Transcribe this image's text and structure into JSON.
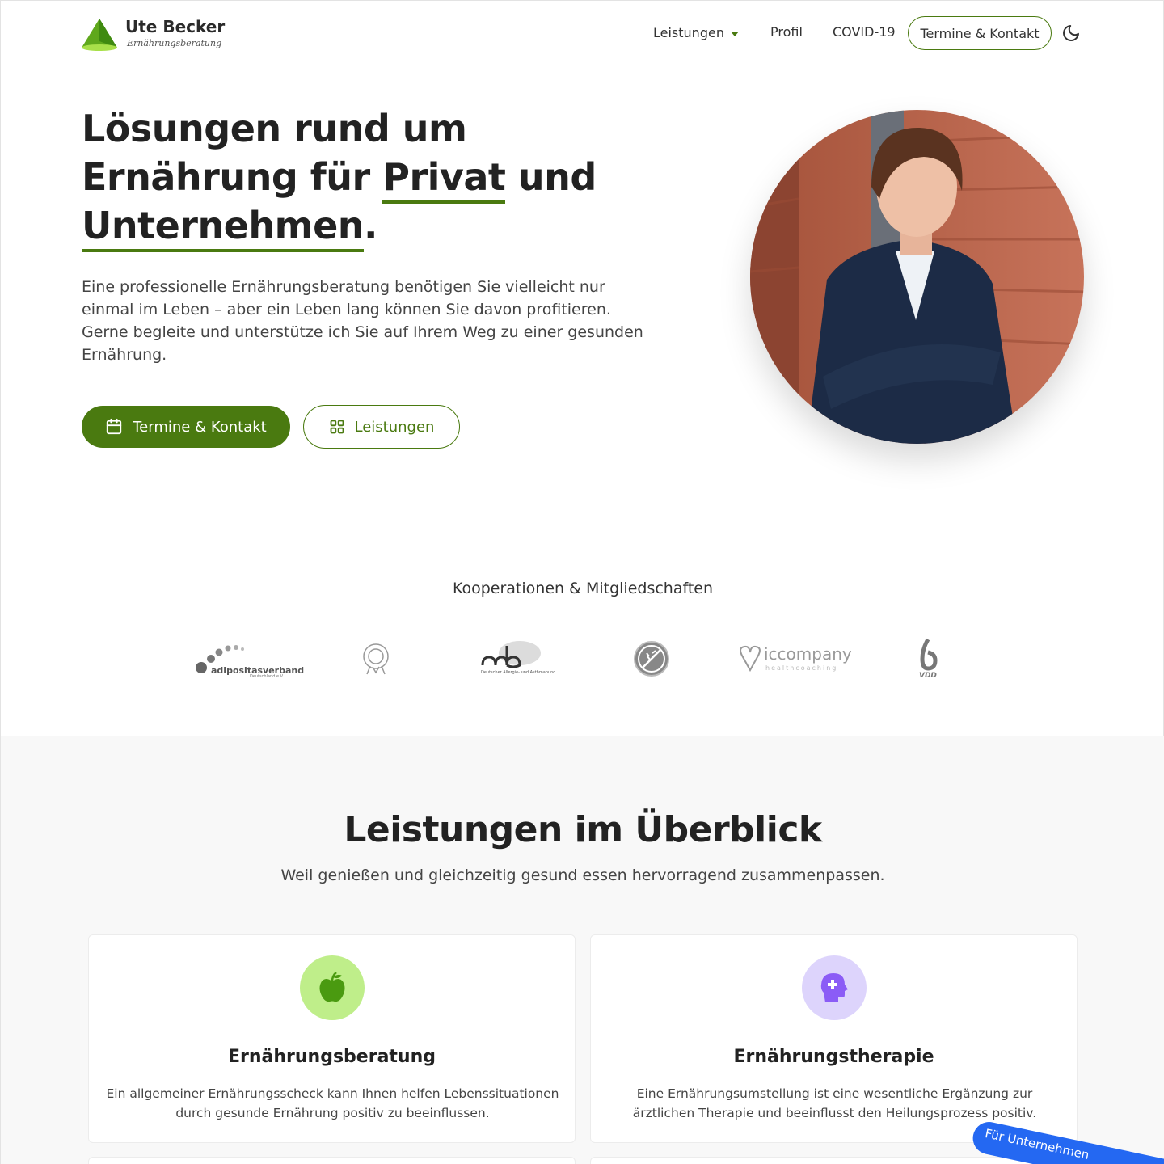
{
  "brand": {
    "name": "Ute Becker",
    "tagline": "Ernährungsberatung"
  },
  "nav": {
    "items": [
      {
        "label": "Leistungen"
      },
      {
        "label": "Profil"
      },
      {
        "label": "COVID-19"
      }
    ],
    "cta_label": "Termine & Kontakt"
  },
  "hero": {
    "title_1": "Lösungen rund um",
    "title_2a": "Ernährung für ",
    "title_2b": "Privat",
    "title_2c": " und",
    "title_3a": "Unternehmen",
    "title_3b": ".",
    "text": "Eine professionelle Ernährungsberatung benötigen Sie vielleicht nur einmal im Leben – aber ein Leben lang können Sie davon profitieren. Gerne begleite und unterstütze ich Sie auf Ihrem Weg zu einer gesunden Ernährung.",
    "primary_button": "Termine & Kontakt",
    "secondary_button": "Leistungen"
  },
  "partners": {
    "title": "Kooperationen & Mitgliedschaften",
    "logos": [
      {
        "name": "adipositasverband",
        "sub": "Deutschland e.V."
      },
      {
        "name": "emblem"
      },
      {
        "name": "dab",
        "sub": "Deutscher Allergie- und Asthmabund"
      },
      {
        "name": "glutenfrei"
      },
      {
        "name": "iccompany",
        "sub": "healthcoaching"
      },
      {
        "name": "VDD"
      }
    ]
  },
  "services": {
    "title": "Leistungen im Überblick",
    "subtitle": "Weil genießen und gleichzeitig gesund essen hervorragend zusammenpassen.",
    "cards": [
      {
        "title": "Ernährungsberatung",
        "text": "Ein allgemeiner Ernährungsscheck kann Ihnen helfen Lebenssituationen durch gesunde Ernährung positiv zu beeinflussen.",
        "icon": "apple-icon",
        "icon_bg": "#bfee8a",
        "icon_color": "#4a9a10"
      },
      {
        "title": "Ernährungstherapie",
        "text": "Eine Ernährungsumstellung ist eine wesentliche Ergänzung zur ärztlichen Therapie und beeinflusst den Heilungsprozess positiv.",
        "icon": "head-plus-icon",
        "icon_bg": "#ddd4fc",
        "icon_color": "#8b5cf6"
      }
    ]
  },
  "ribbon": {
    "label": "Für Unternehmen"
  },
  "colors": {
    "accent": "#4a7a10",
    "section_bg": "#f8f8f8",
    "ribbon": "#2468f2"
  }
}
